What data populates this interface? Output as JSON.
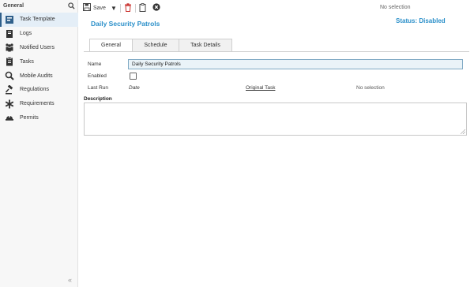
{
  "sidebar": {
    "header": "General",
    "items": [
      {
        "label": "Task Template",
        "icon": "task-template-icon",
        "active": true
      },
      {
        "label": "Logs",
        "icon": "logs-icon",
        "active": false
      },
      {
        "label": "Notified Users",
        "icon": "users-icon",
        "active": false
      },
      {
        "label": "Tasks",
        "icon": "tasks-icon",
        "active": false
      },
      {
        "label": "Mobile Audits",
        "icon": "mobile-audit-icon",
        "active": false
      },
      {
        "label": "Regulations",
        "icon": "gavel-icon",
        "active": false
      },
      {
        "label": "Requirements",
        "icon": "asterisk-icon",
        "active": false
      },
      {
        "label": "Permits",
        "icon": "hard-hat-icon",
        "active": false
      }
    ],
    "collapse_glyph": "«"
  },
  "toolbar": {
    "save_label": "Save",
    "selection_text": "No selection"
  },
  "header": {
    "title": "Daily Security Patrols",
    "status": "Status: Disabled"
  },
  "tabs": [
    {
      "label": "General",
      "active": true
    },
    {
      "label": "Schedule",
      "active": false
    },
    {
      "label": "Task Details",
      "active": false
    }
  ],
  "form": {
    "name_label": "Name",
    "name_value": "Daily Security Patrols",
    "enabled_label": "Enabled",
    "enabled_checked": false,
    "last_run_label": "Last Run",
    "last_run_value": "Date",
    "original_task_link": "Original Task",
    "original_task_value": "No selection",
    "description_label": "Description",
    "description_value": ""
  },
  "colors": {
    "accent": "#2a8fc9",
    "active_nav": "#e4eef7",
    "delete_icon": "#c9302c"
  }
}
